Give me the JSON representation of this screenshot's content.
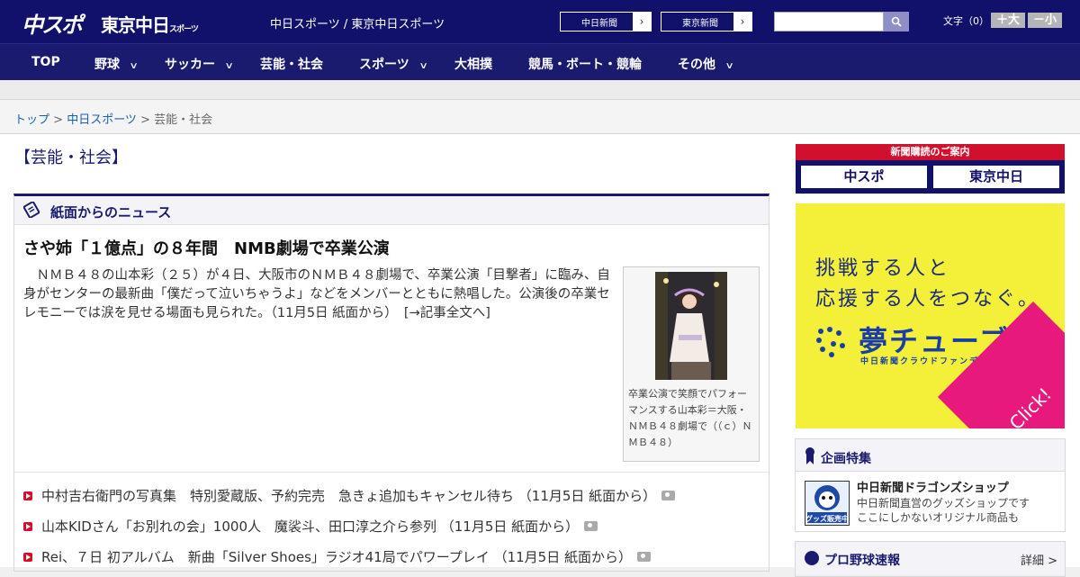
{
  "header": {
    "logo_chunichi_sports": "中スポ",
    "logo_tokyo_chunichi": "東京中日",
    "logo_tokyo_chunichi_small": "スポーツ",
    "site_names": "中日スポーツ / 東京中日スポーツ",
    "paper_links": [
      {
        "label": "中日新聞",
        "arrow": "›"
      },
      {
        "label": "東京新聞",
        "arrow": "›"
      }
    ],
    "search": {
      "placeholder": "",
      "button_icon": "search-icon"
    },
    "font_size": {
      "label": "文字（0）",
      "larger": "＋大",
      "smaller": "－小"
    }
  },
  "nav": {
    "items": [
      {
        "label": "TOP",
        "has_menu": false
      },
      {
        "label": "野球",
        "has_menu": true
      },
      {
        "label": "サッカー",
        "has_menu": true
      },
      {
        "label": "芸能・社会",
        "has_menu": false
      },
      {
        "label": "スポーツ",
        "has_menu": true
      },
      {
        "label": "大相撲",
        "has_menu": false
      },
      {
        "label": "競馬・ボート・競輪",
        "has_menu": false
      },
      {
        "label": "その他",
        "has_menu": true
      }
    ],
    "chevron": "∨"
  },
  "breadcrumb": {
    "items": [
      {
        "label": "トップ",
        "link": true
      },
      {
        "label": "中日スポーツ",
        "link": true
      },
      {
        "label": "芸能・社会",
        "link": false
      }
    ],
    "separator": " > "
  },
  "section": {
    "title": "【芸能・社会】"
  },
  "news": {
    "head_label": "紙面からのニュース",
    "lead": {
      "title": "さや姉「１億点」の８年間　NMB劇場で卒業公演",
      "body": "ＮＭＢ４８の山本彩（２５）が４日、大阪市のＮＭＢ４８劇場で、卒業公演「目撃者」に臨み、自身がセンターの最新曲「僕だって泣いちゃうよ」などをメンバーとともに熱唱した。公演後の卒業セレモニーでは涙を見せる場面も見られた。（11月5日 紙面から）　[→記事全文へ]",
      "photo_caption": "卒業公演で笑顔でパフォーマンスする山本彩＝大阪・ＮＭＢ４８劇場で（（ｃ）ＮＭＢ４８）"
    },
    "list": [
      {
        "text": "中村吉右衛門の写真集　特別愛蔵版、予約完売　急きょ追加もキャンセル待ち （11月5日 紙面から）",
        "has_photo": true
      },
      {
        "text": "山本KIDさん「お別れの会」1000人　魔裟斗、田口淳之介ら参列 （11月5日 紙面から）",
        "has_photo": true
      },
      {
        "text": "Rei、７日 初アルバム　新曲「Silver Shoes」ラジオ41局でパワープレイ （11月5日 紙面から）",
        "has_photo": true
      }
    ]
  },
  "sidebar": {
    "subscription": {
      "head": "新聞購読のご案内",
      "logos": [
        "中スポ",
        "東京中日"
      ]
    },
    "ad": {
      "line1": "挑戦する人と",
      "line2": "応援する人をつなぐ。",
      "brand": "夢チューブ",
      "brand_sub": "中日新聞クラウドファンディング",
      "click": "Click!",
      "colors": {
        "bg": "#f4f03a",
        "accent": "#e8197d",
        "brand": "#1a3ea8"
      }
    },
    "feature": {
      "head": "企画特集",
      "shop_title": "中日新聞ドラゴンズショップ",
      "shop_desc_1": "中日新聞直営のグッズショップです",
      "shop_desc_2": "ここにしかないオリジナル商品も",
      "thumb_text": "グッズ販売中"
    },
    "baseball": {
      "head": "プロ野球速報",
      "detail": "詳細 >"
    }
  }
}
